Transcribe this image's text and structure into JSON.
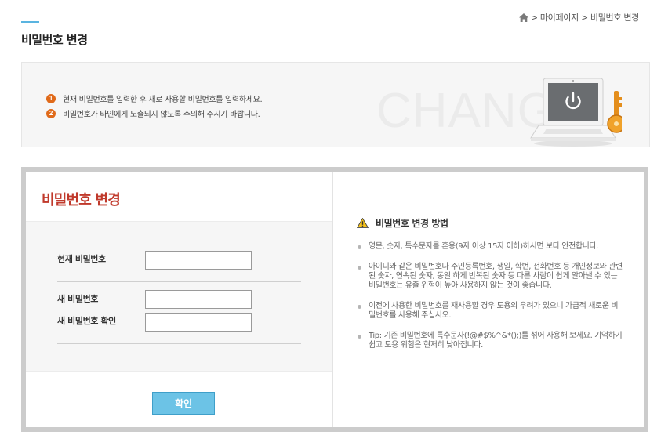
{
  "header": {
    "page_title": "비밀번호 변경",
    "breadcrumb": [
      "마이페이지",
      "비밀번호 변경"
    ],
    "breadcrumb_separator": ">"
  },
  "info": {
    "items": [
      {
        "num": "1",
        "text": "현재 비밀번호를 입력한 후 새로 사용할 비밀번호를 입력하세요."
      },
      {
        "num": "2",
        "text": "비밀번호가 타인에게 노출되지 않도록 주의해 주시기 바랍니다."
      }
    ],
    "watermark": "CHANGE"
  },
  "form": {
    "title": "비밀번호 변경",
    "current_label": "현재 비밀번호",
    "current_value": "",
    "new_label": "새 비밀번호",
    "new_value": "",
    "confirm_label": "새 비밀번호 확인",
    "confirm_value": "",
    "submit_label": "확인"
  },
  "guide": {
    "title": "비밀번호 변경 방법",
    "items": [
      "영문, 숫자, 특수문자를 혼용(9자 이상 15자 이하)하시면 보다 안전합니다.",
      "아이디와 같은 비밀번호나 주민등록번호, 생일, 학번, 전화번호 등 개인정보와 관련된 숫자, 연속된 숫자, 동일 하게 반복된 숫자 등 다른 사람이 쉽게 알아낼 수 있는 비밀번호는 유출 위험이 높아 사용하지 않는 것이 좋습니다.",
      "이전에 사용한 비밀번호를 재사용할 경우 도용의 우려가 있으니 가급적 새로운 비밀번호를 사용해 주십시오.",
      "Tip: 기존 비밀번호에 특수문자(!@#$%^&*();)를 섞어 사용해 보세요. 기억하기 쉽고 도용 위험은 현저히 낮아집니다."
    ]
  },
  "colors": {
    "accent_orange": "#e06a1a",
    "title_red": "#c0392b",
    "button_blue": "#6cc3e6",
    "panel_border": "#cccccc"
  },
  "icons": [
    "home-icon",
    "warning-icon",
    "laptop-lock-icon"
  ]
}
